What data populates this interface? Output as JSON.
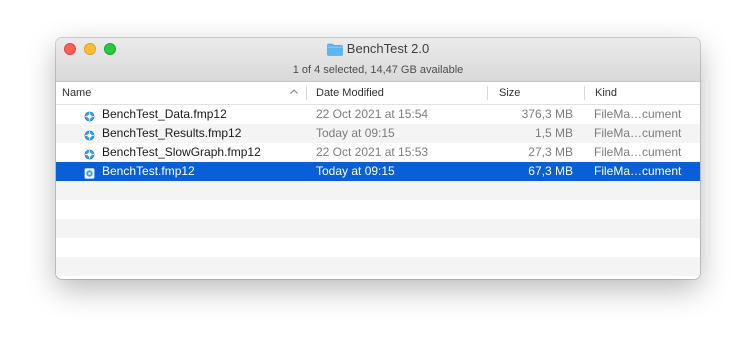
{
  "window": {
    "title": "BenchTest 2.0",
    "status": "1 of 4 selected, 14,47 GB available"
  },
  "columns": {
    "name": "Name",
    "date": "Date Modified",
    "size": "Size",
    "kind": "Kind"
  },
  "files": [
    {
      "name": "BenchTest_Data.fmp12",
      "date": "22 Oct 2021 at 15:54",
      "size": "376,3 MB",
      "kind": "FileMa…cument"
    },
    {
      "name": "BenchTest_Results.fmp12",
      "date": "Today at 09:15",
      "size": "1,5 MB",
      "kind": "FileMa…cument"
    },
    {
      "name": "BenchTest_SlowGraph.fmp12",
      "date": "22 Oct 2021 at 15:53",
      "size": "27,3 MB",
      "kind": "FileMa…cument"
    },
    {
      "name": "BenchTest.fmp12",
      "date": "Today at 09:15",
      "size": "67,3 MB",
      "kind": "FileMa…cument"
    }
  ],
  "selected_index": 3,
  "icons": {
    "folder": "folder-icon",
    "file": "filemaker-file-icon",
    "sort": "chevron-up-icon"
  },
  "colors": {
    "selection": "#0a5fd7",
    "close": "#fe5f57",
    "minimize": "#febc2e",
    "maximize": "#28c840",
    "folder": "#5cb6f2"
  }
}
